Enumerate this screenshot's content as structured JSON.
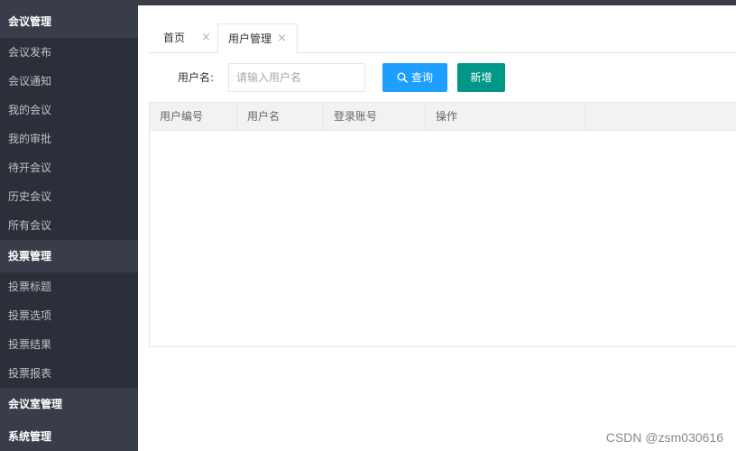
{
  "sidebar": {
    "groups": [
      {
        "title": "会议管理",
        "items": [
          "会议发布",
          "会议通知",
          "我的会议",
          "我的审批",
          "待开会议",
          "历史会议",
          "所有会议"
        ]
      },
      {
        "title": "投票管理",
        "items": [
          "投票标题",
          "投票选项",
          "投票结果",
          "投票报表"
        ]
      },
      {
        "title": "会议室管理",
        "items": []
      },
      {
        "title": "系统管理",
        "items": []
      }
    ]
  },
  "tabs": [
    {
      "label": "首页",
      "close": "×"
    },
    {
      "label": "用户管理",
      "close": "×"
    }
  ],
  "search": {
    "label": "用户名:",
    "placeholder": "请输入用户名",
    "value": "",
    "query_button": "查询",
    "query_icon": "search-icon",
    "add_button": "新增"
  },
  "table": {
    "columns": [
      "用户编号",
      "用户名",
      "登录账号",
      "操作"
    ],
    "rows": []
  },
  "watermark": "CSDN @zsm030616",
  "colors": {
    "sidebar_bg": "#2b2f3a",
    "group_bg": "#393d49",
    "query_button": "#1e9fff",
    "add_button": "#009688"
  }
}
